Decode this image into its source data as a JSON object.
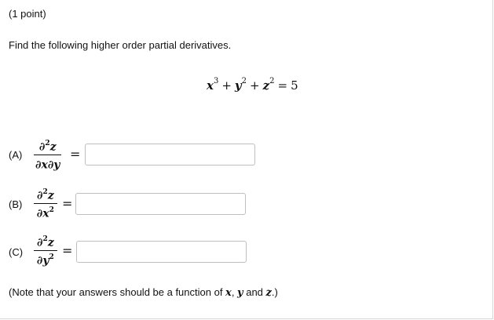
{
  "header": {
    "points": "(1 point)",
    "instruction": "Find the following higher order partial derivatives."
  },
  "equation": {
    "x": "x",
    "x_exp": "3",
    "plus1": "+",
    "y": "y",
    "y_exp": "2",
    "plus2": "+",
    "z": "z",
    "z_exp": "2",
    "equals": "=",
    "rhs": "5"
  },
  "parts": [
    {
      "label": "(A)",
      "num_main": "∂",
      "num_exp": "2",
      "num_var": "z",
      "den": "∂x∂y",
      "den_exp": "",
      "equals": "=",
      "answer": ""
    },
    {
      "label": "(B)",
      "num_main": "∂",
      "num_exp": "2",
      "num_var": "z",
      "den": "∂x",
      "den_exp": "2",
      "equals": "=",
      "answer": ""
    },
    {
      "label": "(C)",
      "num_main": "∂",
      "num_exp": "2",
      "num_var": "z",
      "den": "∂y",
      "den_exp": "2",
      "equals": "=",
      "answer": ""
    }
  ],
  "note": {
    "prefix": "(Note that your answers should be a function of ",
    "x": "x",
    "sep1": ", ",
    "y": "y",
    "sep2": " and ",
    "z": "z",
    "suffix": ".)"
  }
}
